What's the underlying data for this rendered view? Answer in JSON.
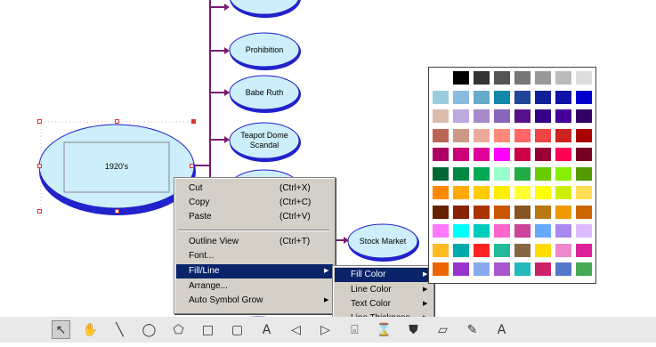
{
  "diagram": {
    "central_topic": "1920's",
    "subtopics": [
      {
        "label": "Prohibition"
      },
      {
        "label": "Babe Ruth"
      },
      {
        "label_line1": "Teapot Dome",
        "label_line2": "Scandal"
      },
      {
        "label": "Stock Market"
      }
    ],
    "colors": {
      "node_fill": "#cdeefb",
      "node_border": "#2222cc",
      "connector": "#7a1a6e"
    }
  },
  "context_menu": {
    "items": [
      {
        "label": "Cut",
        "shortcut": "(Ctrl+X)"
      },
      {
        "label": "Copy",
        "shortcut": "(Ctrl+C)"
      },
      {
        "label": "Paste",
        "shortcut": "(Ctrl+V)"
      },
      {
        "label": "Outline View",
        "shortcut": "(Ctrl+T)"
      },
      {
        "label": "Font..."
      },
      {
        "label": "Fill/Line",
        "has_submenu": true,
        "highlighted": true
      },
      {
        "label": "Arrange..."
      },
      {
        "label": "Auto Symbol Grow",
        "has_submenu": true
      }
    ]
  },
  "fill_line_submenu": {
    "items": [
      {
        "label": "Fill Color",
        "has_submenu": true,
        "highlighted": true
      },
      {
        "label": "Line Color",
        "has_submenu": true
      },
      {
        "label": "Text Color",
        "has_submenu": true
      },
      {
        "label": "Line Thickness",
        "has_submenu": true
      }
    ]
  },
  "color_palette": {
    "rows": [
      [
        "#ffffff",
        "#000000",
        "#333333",
        "#555555",
        "#777777",
        "#999999",
        "#bbbbbb",
        "#dddddd"
      ],
      [
        "#99ccdd",
        "#88bbdd",
        "#66aacc",
        "#1188aa",
        "#224499",
        "#112299",
        "#1111aa",
        "#0000cc"
      ],
      [
        "#ddbbaa",
        "#bbaadd",
        "#aa88cc",
        "#8866bb",
        "#551188",
        "#330088",
        "#440099",
        "#330066"
      ],
      [
        "#bb6655",
        "#cc9988",
        "#eeaa99",
        "#ff8877",
        "#ff6666",
        "#ee4444",
        "#cc2222",
        "#aa0000"
      ],
      [
        "#aa0066",
        "#cc0077",
        "#dd0099",
        "#ff00ff",
        "#cc0044",
        "#990033",
        "#ff0055",
        "#770022"
      ],
      [
        "#006633",
        "#008844",
        "#00aa55",
        "#99ffcc",
        "#22aa44",
        "#66cc00",
        "#88ee00",
        "#559900"
      ],
      [
        "#ff8800",
        "#ffaa00",
        "#ffcc00",
        "#ffee00",
        "#ffff33",
        "#ffff00",
        "#ccee00",
        "#ffdd55"
      ],
      [
        "#662200",
        "#882200",
        "#aa3300",
        "#cc5500",
        "#885522",
        "#bb7711",
        "#ee9900",
        "#cc6600"
      ],
      [
        "#ff77ff",
        "#00ffff",
        "#00ccbb",
        "#ff66cc",
        "#cc4499",
        "#66aaff",
        "#aa88ee",
        "#ddbbff"
      ],
      [
        "#ffbb22",
        "#00aaaa",
        "#ff2222",
        "#22bb99",
        "#886644",
        "#ffdd00",
        "#ee88cc",
        "#dd2299"
      ],
      [
        "#ee6600",
        "#9933cc",
        "#88aaee",
        "#aa55cc",
        "#22bbbb",
        "#cc2266",
        "#5577cc",
        "#44aa55"
      ]
    ]
  },
  "toolbar": {
    "tools": [
      {
        "icon": "pointer-icon",
        "glyph": "↖"
      },
      {
        "icon": "hand-icon",
        "glyph": "✋"
      },
      {
        "icon": "line-icon",
        "glyph": "╲"
      },
      {
        "icon": "ellipse-icon",
        "glyph": "◯"
      },
      {
        "icon": "pentagon-icon",
        "glyph": "⬠"
      },
      {
        "icon": "rectangle-icon",
        "glyph": "□"
      },
      {
        "icon": "rounded-rect-icon",
        "glyph": "▢"
      },
      {
        "icon": "text-box-icon",
        "glyph": "A"
      },
      {
        "icon": "arrow-left-icon",
        "glyph": "◁"
      },
      {
        "icon": "arrow-right-icon",
        "glyph": "▷"
      },
      {
        "icon": "cylinder-icon",
        "glyph": "⌻"
      },
      {
        "icon": "hourglass-icon",
        "glyph": "⌛"
      },
      {
        "icon": "paint-bucket-icon",
        "glyph": "⛊"
      },
      {
        "icon": "note-icon",
        "glyph": "▱"
      },
      {
        "icon": "brush-icon",
        "glyph": "✎"
      },
      {
        "icon": "font-style-icon",
        "glyph": "A"
      }
    ]
  }
}
